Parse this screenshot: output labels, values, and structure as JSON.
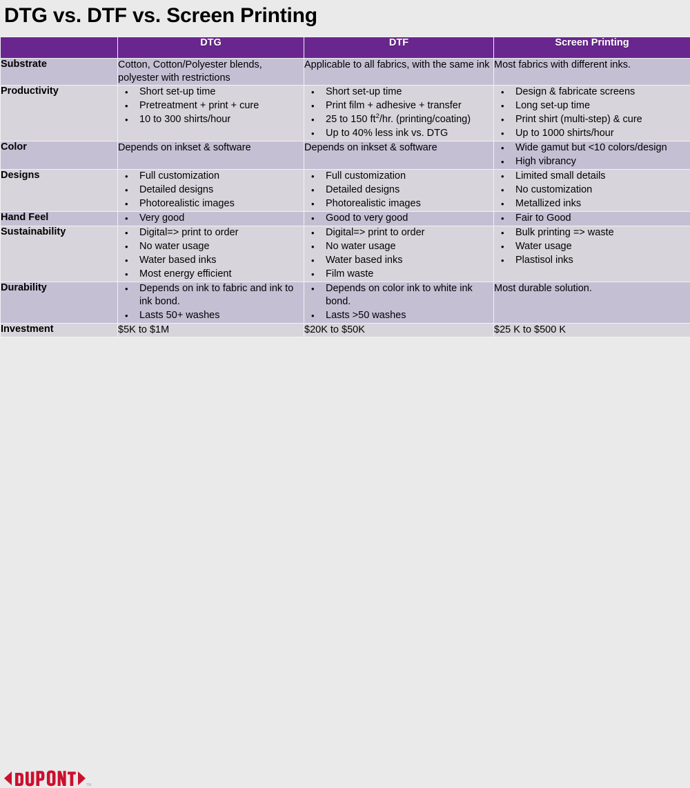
{
  "slide": {
    "title": "DTG vs. DTF vs. Screen Printing",
    "background_color": "#eaeaea"
  },
  "theme": {
    "header_purple": "#69268e",
    "band_dark": "#c5bfd4",
    "band_light": "#d7d5db",
    "grid_line": "#f2f2f2",
    "logo_red": "#cc0f2e",
    "text_color": "#000000",
    "header_text_color": "#ffffff"
  },
  "table": {
    "columns": [
      {
        "key": "feature",
        "label": ""
      },
      {
        "key": "dtg",
        "label": "DTG"
      },
      {
        "key": "dtf",
        "label": "DTF"
      },
      {
        "key": "sp",
        "label": "Screen Printing"
      }
    ],
    "rows": [
      {
        "feature": "Substrate",
        "band": "dark",
        "dtg": {
          "type": "text",
          "text": "Cotton, Cotton/Polyester blends, polyester with restrictions"
        },
        "dtf": {
          "type": "text",
          "text": "Applicable to all fabrics, with the same ink"
        },
        "sp": {
          "type": "text",
          "text": "Most fabrics with different inks."
        }
      },
      {
        "feature": "Productivity",
        "band": "light",
        "dtg": {
          "type": "bullets",
          "items": [
            "Short set-up time",
            "Pretreatment + print + cure",
            "10 to 300 shirts/hour"
          ]
        },
        "dtf": {
          "type": "bullets",
          "items": [
            "Short set-up time",
            "Print film + adhesive + transfer",
            "25 to 150 ft2/hr. (printing/coating)",
            "Up to 40% less ink vs. DTG"
          ]
        },
        "sp": {
          "type": "bullets",
          "items": [
            "Design & fabricate screens",
            "Long set-up time",
            "Print shirt (multi-step) & cure",
            "Up to 1000 shirts/hour"
          ]
        }
      },
      {
        "feature": "Color",
        "band": "dark",
        "dtg": {
          "type": "text",
          "text": "Depends on inkset & software"
        },
        "dtf": {
          "type": "text",
          "text": "Depends on inkset & software"
        },
        "sp": {
          "type": "bullets",
          "items": [
            "Wide gamut but <10 colors/design",
            "High vibrancy"
          ]
        }
      },
      {
        "feature": "Designs",
        "band": "light",
        "dtg": {
          "type": "bullets",
          "items": [
            "Full customization",
            "Detailed designs",
            "Photorealistic images"
          ]
        },
        "dtf": {
          "type": "bullets",
          "items": [
            "Full customization",
            "Detailed designs",
            "Photorealistic images"
          ]
        },
        "sp": {
          "type": "bullets",
          "items": [
            "Limited small details",
            "No customization",
            "Metallized inks"
          ]
        }
      },
      {
        "feature": "Hand Feel",
        "band": "dark",
        "dtg": {
          "type": "bullets",
          "items": [
            "Very good"
          ]
        },
        "dtf": {
          "type": "bullets",
          "items": [
            "Good to very good"
          ]
        },
        "sp": {
          "type": "bullets",
          "items": [
            "Fair to Good"
          ]
        }
      },
      {
        "feature": "Sustainability",
        "band": "light",
        "dtg": {
          "type": "bullets",
          "items": [
            "Digital=> print to order",
            "No water usage",
            "Water based inks",
            "Most energy efficient"
          ]
        },
        "dtf": {
          "type": "bullets",
          "items": [
            "Digital=> print to order",
            "No water usage",
            "Water based inks",
            "Film waste"
          ]
        },
        "sp": {
          "type": "bullets",
          "items": [
            "Bulk printing => waste",
            "Water usage",
            "Plastisol inks"
          ]
        }
      },
      {
        "feature": "Durability",
        "band": "dark",
        "dtg": {
          "type": "bullets",
          "items": [
            "Depends on ink to fabric and ink to ink bond.",
            "Lasts 50+ washes"
          ]
        },
        "dtf": {
          "type": "bullets",
          "items": [
            "Depends on color ink to white ink bond.",
            "Lasts >50 washes"
          ]
        },
        "sp": {
          "type": "text",
          "text": "Most durable solution."
        }
      },
      {
        "feature": "Investment",
        "band": "light",
        "dtg": {
          "type": "text",
          "text": "$5K to $1M"
        },
        "dtf": {
          "type": "text",
          "text": "$20K to $50K"
        },
        "sp": {
          "type": "text",
          "text": "$25 K to $500 K"
        }
      }
    ]
  },
  "footer": {
    "logo_text": "DUPONT",
    "logo_trademark": "TM"
  }
}
